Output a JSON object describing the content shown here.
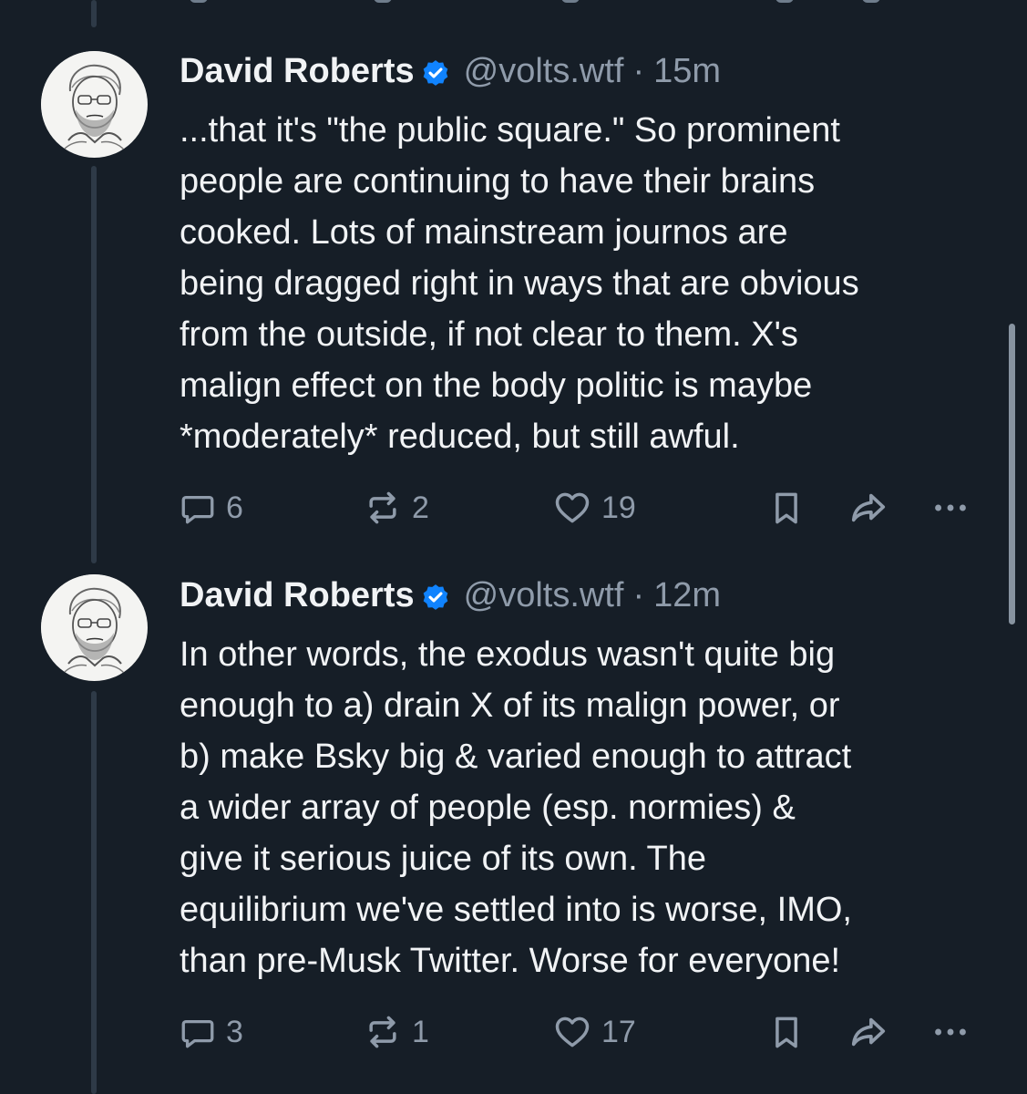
{
  "posts": [
    {
      "author_name": "David Roberts",
      "handle": "@volts.wtf",
      "separator": "·",
      "time": "15m",
      "text_lines": [
        "...that it's \"the public square.\" So prominent",
        "people are continuing to have their brains",
        "cooked. Lots of mainstream journos are",
        "being dragged right in ways that are obvious",
        "from the outside, if not clear to them. X's",
        "malign effect on the body politic is maybe",
        "*moderately* reduced, but still awful."
      ],
      "reply_count": "6",
      "repost_count": "2",
      "like_count": "19"
    },
    {
      "author_name": "David Roberts",
      "handle": "@volts.wtf",
      "separator": "·",
      "time": "12m",
      "text_lines": [
        "In other words, the exodus wasn't quite big",
        "enough to a) drain X of its malign power, or",
        "b) make Bsky big & varied enough to attract",
        "a wider array of people (esp. normies) &",
        "give it serious juice of its own. The",
        "equilibrium we've settled into is worse, IMO,",
        "than pre-Musk Twitter. Worse for everyone!"
      ],
      "reply_count": "3",
      "repost_count": "1",
      "like_count": "17"
    }
  ],
  "icons": {
    "verified": "verified-badge-icon",
    "reply": "speech-bubble-icon",
    "repost": "repost-arrows-icon",
    "like": "heart-icon",
    "bookmark": "bookmark-icon",
    "share": "share-arrow-icon",
    "more": "ellipsis-icon"
  },
  "colors": {
    "background": "#161e27",
    "text": "#f1f3f5",
    "muted": "#8f9baa",
    "verified": "#1083fe",
    "thread_line": "#2e3a47"
  }
}
